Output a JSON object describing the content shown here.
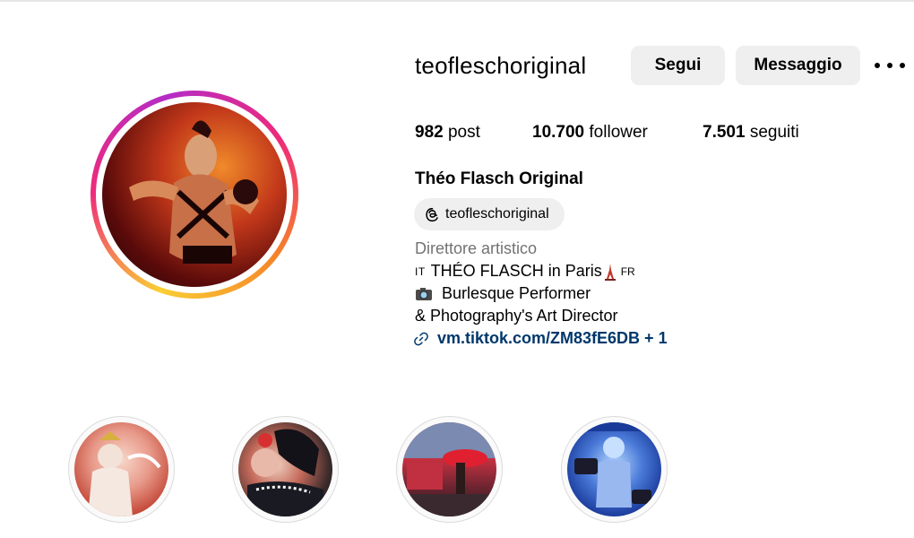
{
  "profile": {
    "username": "teofleschoriginal",
    "full_name": "Théo Flasch Original",
    "threads_handle": "teofleschoriginal",
    "category": "Direttore artistico",
    "bio": {
      "line1_flag_left": "IT",
      "line1_text": "THÉO FLASCH in Paris",
      "line1_flag_right": "FR",
      "line2_text": "Burlesque Performer",
      "line3_text": "& Photography's Art Director"
    },
    "link_text": "vm.tiktok.com/ZM83fE6DB + 1"
  },
  "actions": {
    "follow_label": "Segui",
    "message_label": "Messaggio"
  },
  "stats": {
    "posts_count": "982",
    "posts_label": "post",
    "followers_count": "10.700",
    "followers_label": "follower",
    "following_count": "7.501",
    "following_label": "seguiti"
  },
  "icons": [
    "more-options-icon",
    "threads-icon",
    "link-icon",
    "camera-icon",
    "eiffel-tower-icon"
  ],
  "colors": {
    "button_bg": "#efefef",
    "link": "#00376b",
    "muted_text": "#737373",
    "story_ring_gradient": [
      "#f9ce34",
      "#ee2a7b",
      "#b42cc6"
    ]
  },
  "highlights_count": 4
}
